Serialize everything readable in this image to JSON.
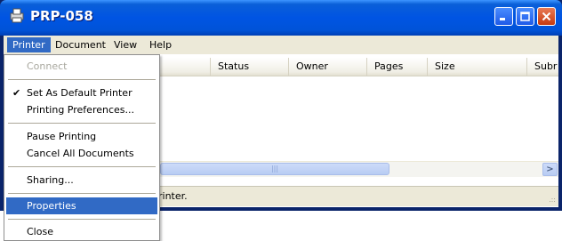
{
  "window": {
    "title": "PRP-058",
    "icon": "printer-icon"
  },
  "menubar": {
    "items": [
      "Printer",
      "Document",
      "View",
      "Help"
    ]
  },
  "columns": [
    "Status",
    "Owner",
    "Pages",
    "Size",
    "Subr"
  ],
  "status_bar": {
    "text": "rinter."
  },
  "printer_menu": {
    "items": [
      {
        "label": "Connect",
        "enabled": false,
        "checked": false
      },
      {
        "label": "Set As Default Printer",
        "enabled": true,
        "checked": true
      },
      {
        "label": "Printing Preferences...",
        "enabled": true,
        "checked": false
      },
      {
        "label": "Pause Printing",
        "enabled": true,
        "checked": false
      },
      {
        "label": "Cancel All Documents",
        "enabled": true,
        "checked": false
      },
      {
        "label": "Sharing...",
        "enabled": true,
        "checked": false
      },
      {
        "label": "Properties",
        "enabled": true,
        "checked": false,
        "highlighted": true
      },
      {
        "label": "Close",
        "enabled": true,
        "checked": false
      }
    ]
  },
  "colors": {
    "title_blue": "#0054e3",
    "menu_highlight": "#316ac5",
    "close_red": "#c63a10"
  }
}
